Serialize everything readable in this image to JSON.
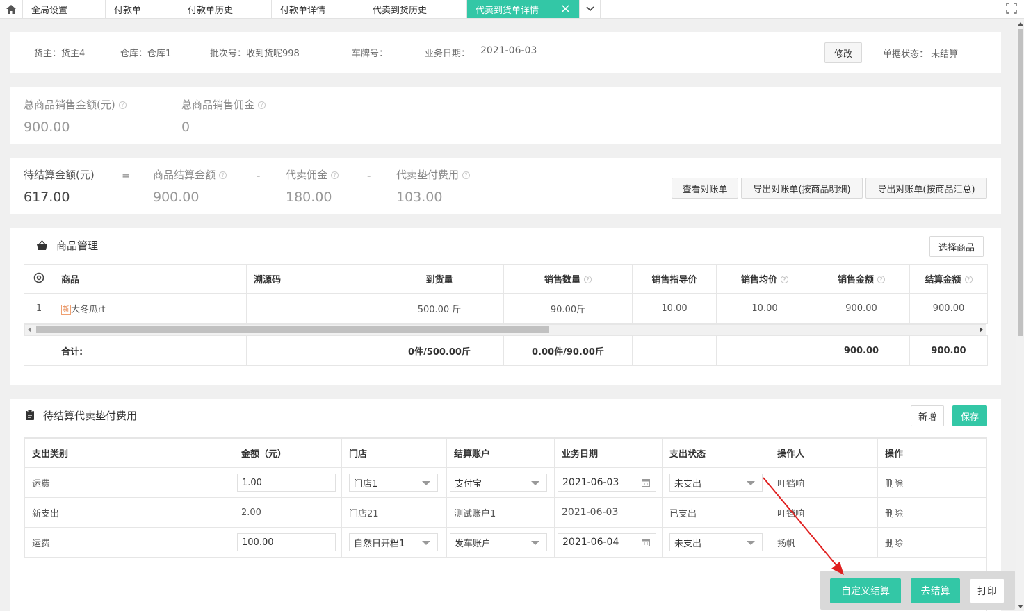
{
  "tabs": [
    {
      "label": "全局设置"
    },
    {
      "label": "付款单"
    },
    {
      "label": "付款单历史"
    },
    {
      "label": "付款单详情"
    },
    {
      "label": "代卖到货历史"
    },
    {
      "label": "代卖到货单详情",
      "close": "×"
    }
  ],
  "colors": {
    "accent": "#33c7a6"
  },
  "header": {
    "owner": "货主：货主4",
    "warehouse": "仓库：仓库1",
    "batch": "批次号：收到货呢998",
    "plate": "车牌号：",
    "date_label": "业务日期：",
    "date_value": "2021-06-03",
    "edit_button": "修改",
    "status": "单据状态：  未结算"
  },
  "summary": {
    "total_sales_label": "总商品销售金额(元)",
    "total_sales_value": "900.00",
    "total_commission_label": "总商品销售佣金",
    "total_commission_value": "0"
  },
  "settlement": {
    "pending_label": "待结算金额(元)",
    "pending_value": "617.00",
    "op_eq": "=",
    "goods_label": "商品结算金额",
    "goods_value": "900.00",
    "op_minus1": "-",
    "commission_label": "代卖佣金",
    "commission_value": "180.00",
    "op_minus2": "-",
    "advance_label": "代卖垫付费用",
    "advance_value": "103.00",
    "btn_view": "查看对账单",
    "btn_export_detail": "导出对账单(按商品明细)",
    "btn_export_summary": "导出对账单(按商品汇总)"
  },
  "goods": {
    "title": "商品管理",
    "select_button": "选择商品",
    "columns": [
      "商品",
      "溯源码",
      "到货量",
      "销售数量",
      "销售指导价",
      "销售均价",
      "销售金额",
      "结算金额"
    ],
    "row": {
      "index": "1",
      "badge": "新",
      "name": "大冬瓜rt",
      "trace": "",
      "arrival": "500.00 斤",
      "sales_qty": "90.00斤",
      "guide_price": "10.00",
      "avg_price": "10.00",
      "sales_amount": "900.00",
      "settle_amount": "900.00"
    },
    "total": {
      "label": "合计:",
      "arrival": "0件/500.00斤",
      "sales_qty": "0.00件/90.00斤",
      "sales_amount": "900.00",
      "settle_amount": "900.00"
    }
  },
  "fees": {
    "title": "待结算代卖垫付费用",
    "add_button": "新增",
    "save_button": "保存",
    "columns": [
      "支出类别",
      "金额（元）",
      "门店",
      "结算账户",
      "业务日期",
      "支出状态",
      "操作人",
      "操作"
    ],
    "rows": [
      {
        "category": "运费",
        "amount": "1.00",
        "store": "门店1",
        "account": "支付宝",
        "date": "2021-06-03",
        "status": "未支出",
        "operator": "叮铛响",
        "action": "删除",
        "editable": true
      },
      {
        "category": "新支出",
        "amount": "2.00",
        "store": "门店21",
        "account": "测试账户1",
        "date": "2021-06-03",
        "status": "已支出",
        "operator": "叮铛响",
        "action": "删除",
        "editable": false
      },
      {
        "category": "运费",
        "amount": "100.00",
        "store": "自然日开档1",
        "account": "发车账户",
        "date": "2021-06-04",
        "status": "未支出",
        "operator": "扬帆",
        "action": "删除",
        "editable": true
      }
    ]
  },
  "footer": {
    "custom_settle": "自定义结算",
    "settle": "去结算",
    "print": "打印"
  }
}
